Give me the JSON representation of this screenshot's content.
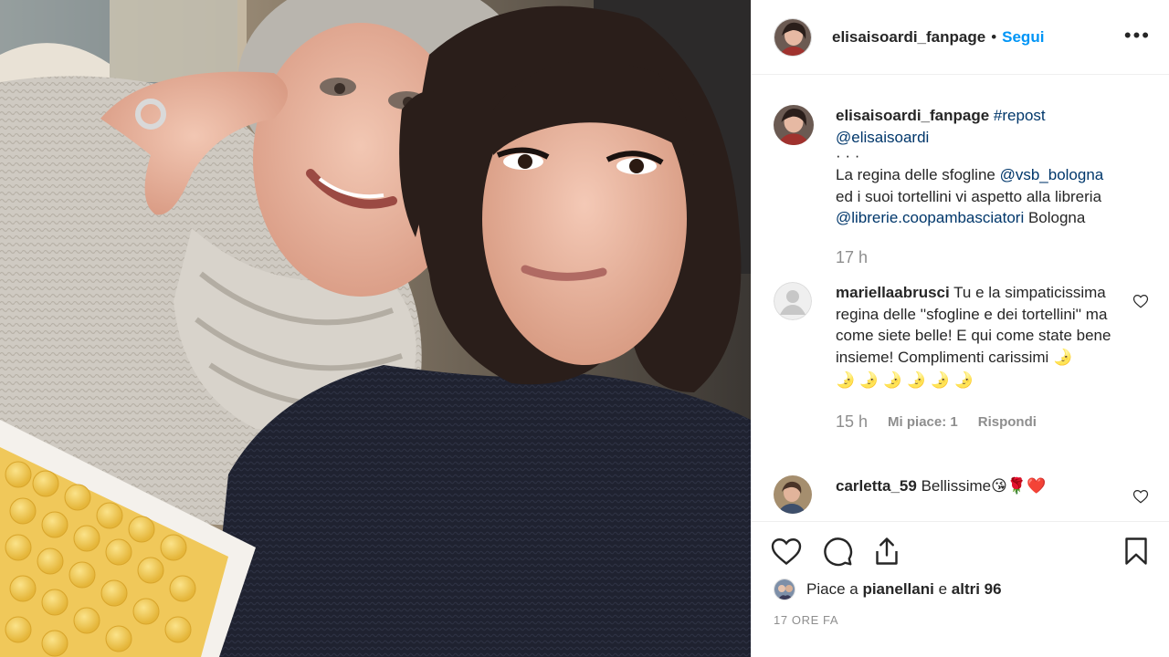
{
  "post": {
    "username": "elisaisoardi_fanpage",
    "separator": "•",
    "follow_label": "Segui",
    "more_label": "•••"
  },
  "caption": {
    "username": "elisaisoardi_fanpage",
    "hashtag": "#repost",
    "mention_author": "@elisaisoardi",
    "dots": "·  ·  ·",
    "text_1": "La regina delle sfogline ",
    "mention_1": "@vsb_bologna",
    "text_2": "ed i suoi tortellini vi aspetto alla libreria",
    "mention_2": "@librerie.coopambasciatori",
    "text_3": " Bologna",
    "time": "17 h"
  },
  "comments": [
    {
      "username": "mariellaabrusci",
      "text": "Tu e la simpaticissima regina delle ''sfogline e dei tortellini'' ma come siete belle! E qui come state bene insieme! Complimenti carissimi",
      "emoji_line": "🌛 🌛 🌛 🌛 🌛 🌛",
      "emoji_inline": "🌛",
      "time": "15 h",
      "likes_label": "Mi piace: 1",
      "reply_label": "Rispondi"
    },
    {
      "username": "carletta_59",
      "text": "Bellissime",
      "emoji": "😘🌹❤️"
    }
  ],
  "actions": {
    "icons": [
      "heart-icon",
      "comment-icon",
      "share-icon",
      "bookmark-icon"
    ],
    "likes_prefix": "Piace a ",
    "likes_user": "pianellani",
    "likes_middle": " e ",
    "likes_others": "altri 96",
    "timestamp": "17 ORE FA"
  }
}
